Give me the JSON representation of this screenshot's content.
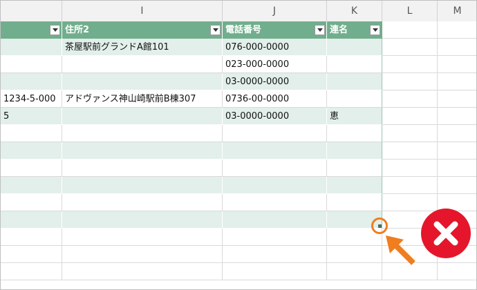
{
  "columns": [
    "I",
    "J",
    "K",
    "L",
    "M"
  ],
  "table": {
    "headers": [
      "",
      "住所2",
      "電話番号",
      "連名"
    ],
    "rows": [
      [
        "",
        "茶屋駅前グランドA館101",
        "076-000-0000",
        ""
      ],
      [
        "",
        "",
        "023-000-0000",
        ""
      ],
      [
        "",
        "",
        "03-0000-0000",
        ""
      ],
      [
        "1234-5-000",
        "アドヴァンス神山崎駅前B棟307",
        "0736-00-0000",
        ""
      ],
      [
        "5",
        "",
        "03-0000-0000",
        "恵"
      ],
      [
        "",
        "",
        "",
        ""
      ],
      [
        "",
        "",
        "",
        ""
      ],
      [
        "",
        "",
        "",
        ""
      ],
      [
        "",
        "",
        "",
        ""
      ],
      [
        "",
        "",
        "",
        ""
      ],
      [
        "",
        "",
        "",
        ""
      ]
    ]
  },
  "colors": {
    "header_bg": "#71ae8d",
    "band_bg": "#e2efea",
    "highlight": "#f07d1e",
    "error": "#e5162b"
  },
  "icons": {
    "filter": "filter-dropdown-icon",
    "resize": "table-resize-handle-icon",
    "pointer": "arrow-pointer-icon",
    "error": "error-x-icon"
  }
}
